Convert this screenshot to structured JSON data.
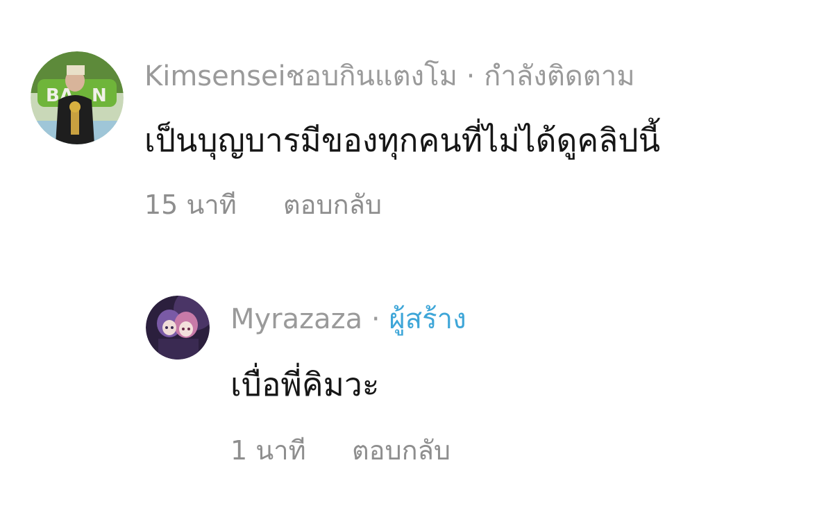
{
  "comments": [
    {
      "username": "Kimsenseiชอบกินแตงโม",
      "separator": " · ",
      "status": "กำลังติดตาม",
      "text": "เป็นบุญบารมีของทุกคนที่ไม่ได้ดูคลิปนี้",
      "time": "15 นาที",
      "reply_label": "ตอบกลับ",
      "avatar_icon": "user-avatar-photo"
    }
  ],
  "replies": [
    {
      "username": "Myrazaza",
      "separator": " · ",
      "badge": "ผู้สร้าง",
      "badge_color": "#3ea6d8",
      "text": "เบื่อพี่คิมวะ",
      "time": "1 นาที",
      "reply_label": "ตอบกลับ",
      "avatar_icon": "creator-avatar-anime"
    }
  ]
}
